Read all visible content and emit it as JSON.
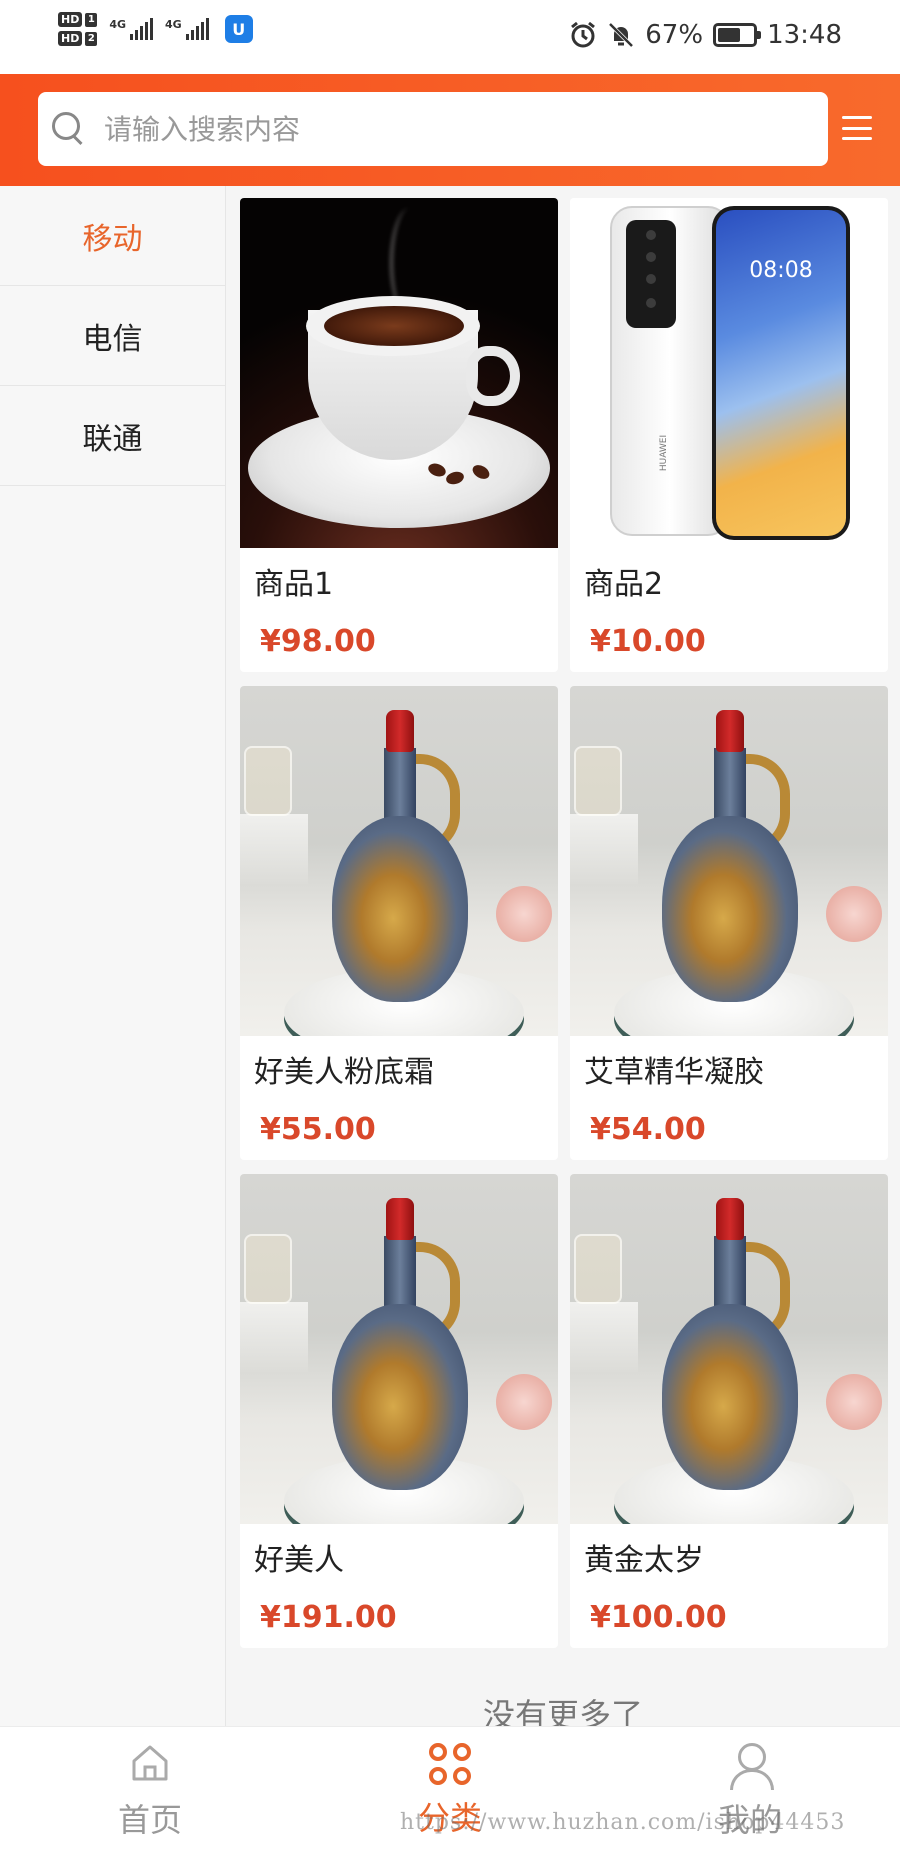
{
  "status_bar": {
    "sim1_label": "HD",
    "sim1_num": "1",
    "sim2_label": "HD",
    "sim2_num": "2",
    "net1": "4G",
    "net2": "4G",
    "app_badge": "U",
    "battery_percent": "67%",
    "battery_level": 0.67,
    "time": "13:48"
  },
  "search": {
    "placeholder": "请输入搜索内容"
  },
  "sidebar": {
    "items": [
      {
        "label": "移动",
        "active": true
      },
      {
        "label": "电信",
        "active": false
      },
      {
        "label": "联通",
        "active": false
      }
    ]
  },
  "products": [
    {
      "name": "商品1",
      "price": "¥98.00",
      "image": "coffee-cup"
    },
    {
      "name": "商品2",
      "price": "¥10.00",
      "image": "smartphone"
    },
    {
      "name": "好美人粉底霜",
      "price": "¥55.00",
      "image": "decorative-vase"
    },
    {
      "name": "艾草精华凝胶",
      "price": "¥54.00",
      "image": "decorative-vase"
    },
    {
      "name": "好美人",
      "price": "¥191.00",
      "image": "decorative-vase"
    },
    {
      "name": "黄金太岁",
      "price": "¥100.00",
      "image": "decorative-vase"
    }
  ],
  "phone_screen_time": "08:08",
  "phone_brand": "HUAWEI",
  "no_more_text": "没有更多了",
  "bottom_nav": {
    "home_label": "首页",
    "category_label": "分类",
    "profile_label": "我的"
  },
  "watermark": "https://www.huzhan.com/ishop44453",
  "colors": {
    "accent": "#f6501e",
    "price": "#d9482a",
    "active_text": "#e8652b"
  }
}
